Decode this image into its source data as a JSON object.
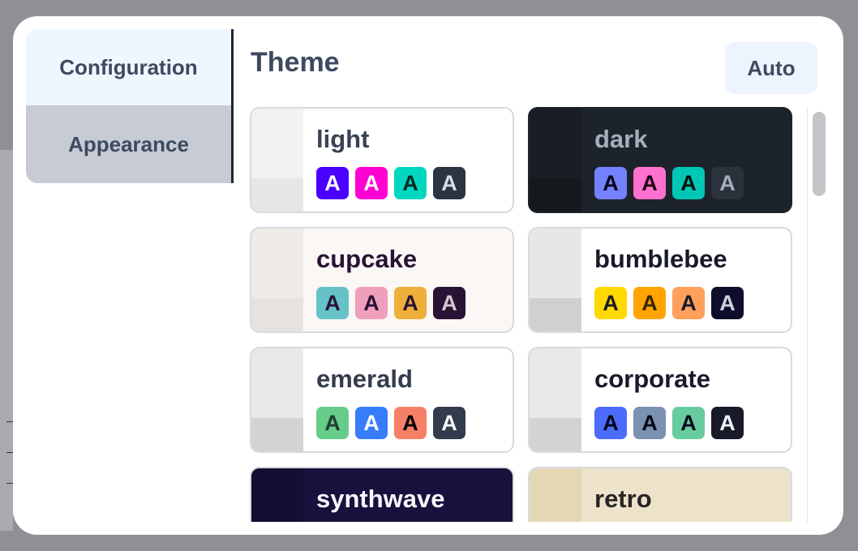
{
  "tabs": [
    {
      "label": "Configuration",
      "active": true
    },
    {
      "label": "Appearance",
      "active": false
    }
  ],
  "theme_title": "Theme",
  "auto_button": "Auto",
  "chip_letter": "A",
  "themes": [
    {
      "name": "light",
      "bg": "#ffffff",
      "text": "#394255",
      "swatch_top": "#f2f2f2",
      "swatch_bot": "#e5e6e6",
      "chips": [
        {
          "bg": "#4a00ff",
          "fg": "#ffffff"
        },
        {
          "bg": "#ff00d3",
          "fg": "#ffffff"
        },
        {
          "bg": "#00d7c0",
          "fg": "#002923"
        },
        {
          "bg": "#2b3440",
          "fg": "#d7dde4"
        }
      ]
    },
    {
      "name": "dark",
      "bg": "#1d232a",
      "text": "#a6adbb",
      "swatch_top": "#191e24",
      "swatch_bot": "#15191e",
      "chips": [
        {
          "bg": "#7582ff",
          "fg": "#050617"
        },
        {
          "bg": "#ff71cf",
          "fg": "#190211"
        },
        {
          "bg": "#00c7b5",
          "fg": "#000e0c"
        },
        {
          "bg": "#2a323c",
          "fg": "#a6adbb"
        }
      ]
    },
    {
      "name": "cupcake",
      "bg": "#faf7f5",
      "text": "#291334",
      "swatch_top": "#efeae6",
      "swatch_bot": "#e7e2df",
      "chips": [
        {
          "bg": "#65c3c8",
          "fg": "#291334"
        },
        {
          "bg": "#ef9fbc",
          "fg": "#291334"
        },
        {
          "bg": "#eeaf3a",
          "fg": "#291334"
        },
        {
          "bg": "#291334",
          "fg": "#d0c8d2"
        }
      ]
    },
    {
      "name": "bumblebee",
      "bg": "#ffffff",
      "text": "#181a2a",
      "swatch_top": "#e7e7e7",
      "swatch_bot": "#d0d0d0",
      "chips": [
        {
          "bg": "#ffd900",
          "fg": "#181a2a"
        },
        {
          "bg": "#ffa400",
          "fg": "#3a2600"
        },
        {
          "bg": "#ffa05c",
          "fg": "#181a2a"
        },
        {
          "bg": "#0e0e2c",
          "fg": "#d0d0e0"
        }
      ]
    },
    {
      "name": "emerald",
      "bg": "#ffffff",
      "text": "#333c4d",
      "swatch_top": "#e9e9e9",
      "swatch_bot": "#d3d3d3",
      "chips": [
        {
          "bg": "#66cc8a",
          "fg": "#223d30"
        },
        {
          "bg": "#377cfb",
          "fg": "#ffffff"
        },
        {
          "bg": "#f68067",
          "fg": "#000000"
        },
        {
          "bg": "#333c4d",
          "fg": "#f9fafb"
        }
      ]
    },
    {
      "name": "corporate",
      "bg": "#ffffff",
      "text": "#181a2a",
      "swatch_top": "#e9e9e9",
      "swatch_bot": "#d3d3d3",
      "chips": [
        {
          "bg": "#4b6bfb",
          "fg": "#050617"
        },
        {
          "bg": "#7b92b2",
          "fg": "#050617"
        },
        {
          "bg": "#67cba0",
          "fg": "#050617"
        },
        {
          "bg": "#181a2a",
          "fg": "#edf2f7"
        }
      ]
    },
    {
      "name": "synthwave",
      "bg": "#1a103d",
      "text": "#f9f7fd",
      "swatch_top": "#160d33",
      "swatch_bot": "#120a2b",
      "chips": [
        {
          "bg": "#e779c1",
          "fg": "#140510"
        },
        {
          "bg": "#58c7f3",
          "fg": "#030f14"
        },
        {
          "bg": "#f3cc30",
          "fg": "#201047"
        },
        {
          "bg": "#221551",
          "fg": "#d7c8fd"
        }
      ]
    },
    {
      "name": "retro",
      "bg": "#ece3ca",
      "text": "#282425",
      "swatch_top": "#e4d8b4",
      "swatch_bot": "#dbca9a",
      "chips": [
        {
          "bg": "#ef9995",
          "fg": "#282425"
        },
        {
          "bg": "#a4cbb4",
          "fg": "#282425"
        },
        {
          "bg": "#dc8850",
          "fg": "#282425"
        },
        {
          "bg": "#2e282a",
          "fg": "#ede6d4"
        }
      ]
    }
  ]
}
